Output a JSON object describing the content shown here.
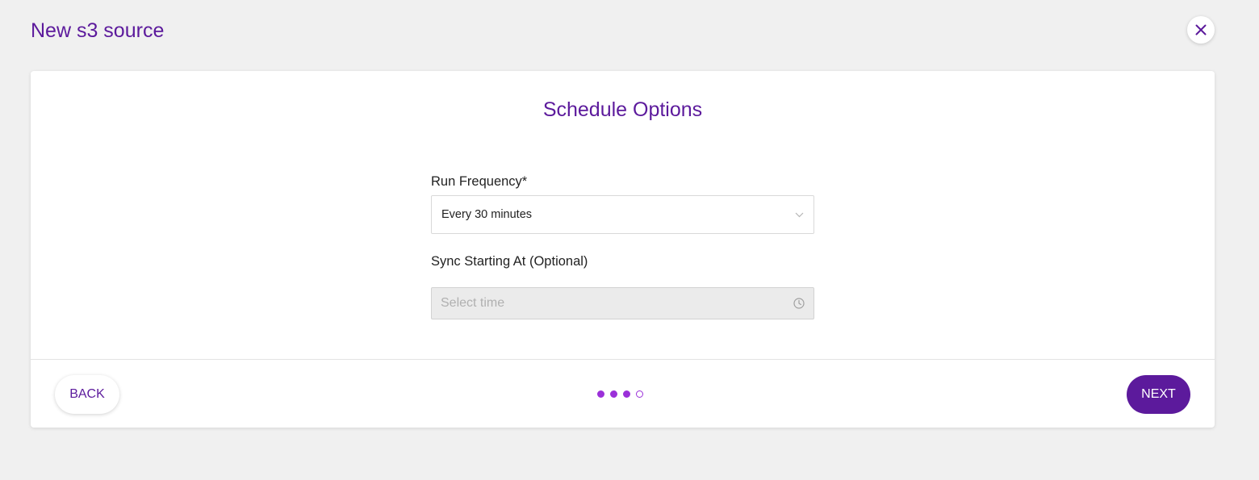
{
  "header": {
    "title": "New s3 source",
    "close_icon": "close-icon"
  },
  "card": {
    "title": "Schedule Options",
    "run_frequency": {
      "label": "Run Frequency*",
      "value": "Every 30 minutes",
      "icon": "chevron-down-icon"
    },
    "sync_start": {
      "label": "Sync Starting At (Optional)",
      "placeholder": "Select time",
      "icon": "clock-icon"
    }
  },
  "footer": {
    "back_label": "BACK",
    "next_label": "NEXT",
    "steps_total": 4,
    "steps_completed": 3
  },
  "colors": {
    "brand": "#5c1a9c",
    "dot": "#9b30d9",
    "background": "#f0f0f0"
  }
}
